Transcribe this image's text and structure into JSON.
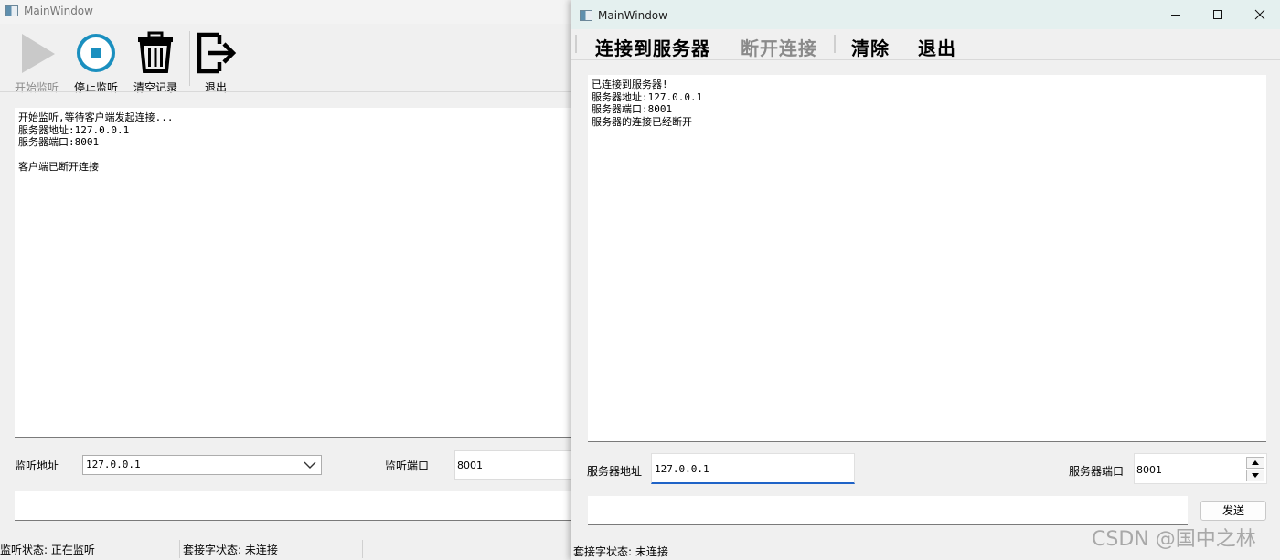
{
  "server_window": {
    "title": "MainWindow",
    "toolbar": {
      "start_label": "开始监听",
      "stop_label": "停止监听",
      "clear_label": "清空记录",
      "exit_label": "退出"
    },
    "log_text": "开始监听,等待客户端发起连接...\n服务器地址:127.0.0.1\n服务器端口:8001\n\n客户端已断开连接",
    "listen_address_label": "监听地址",
    "listen_address_value": "127.0.0.1",
    "listen_port_label": "监听端口",
    "listen_port_value": "8001",
    "status": {
      "listen_status": "监听状态: 正在监听",
      "socket_status": "套接字状态: 未连接"
    }
  },
  "client_window": {
    "title": "MainWindow",
    "menu": {
      "connect": "连接到服务器",
      "disconnect": "断开连接",
      "clear": "清除",
      "exit": "退出"
    },
    "log_text": "已连接到服务器!\n服务器地址:127.0.0.1\n服务器端口:8001\n服务器的连接已经断开",
    "server_address_label": "服务器地址",
    "server_address_value": "127.0.0.1",
    "server_port_label": "服务器端口",
    "server_port_value": "8001",
    "send_label": "发送",
    "status": {
      "socket_status": "套接字状态: 未连接"
    }
  },
  "watermark": "CSDN @国中之林",
  "colors": {
    "accent_blue": "#1f63c7",
    "stop_icon": "#1a8fbf",
    "titlebar_active": "#e4f0ef"
  },
  "icons": [
    "play-icon",
    "stop-icon",
    "trash-icon",
    "exit-icon",
    "minimize-icon",
    "maximize-icon",
    "close-icon",
    "chevron-down-icon"
  ]
}
